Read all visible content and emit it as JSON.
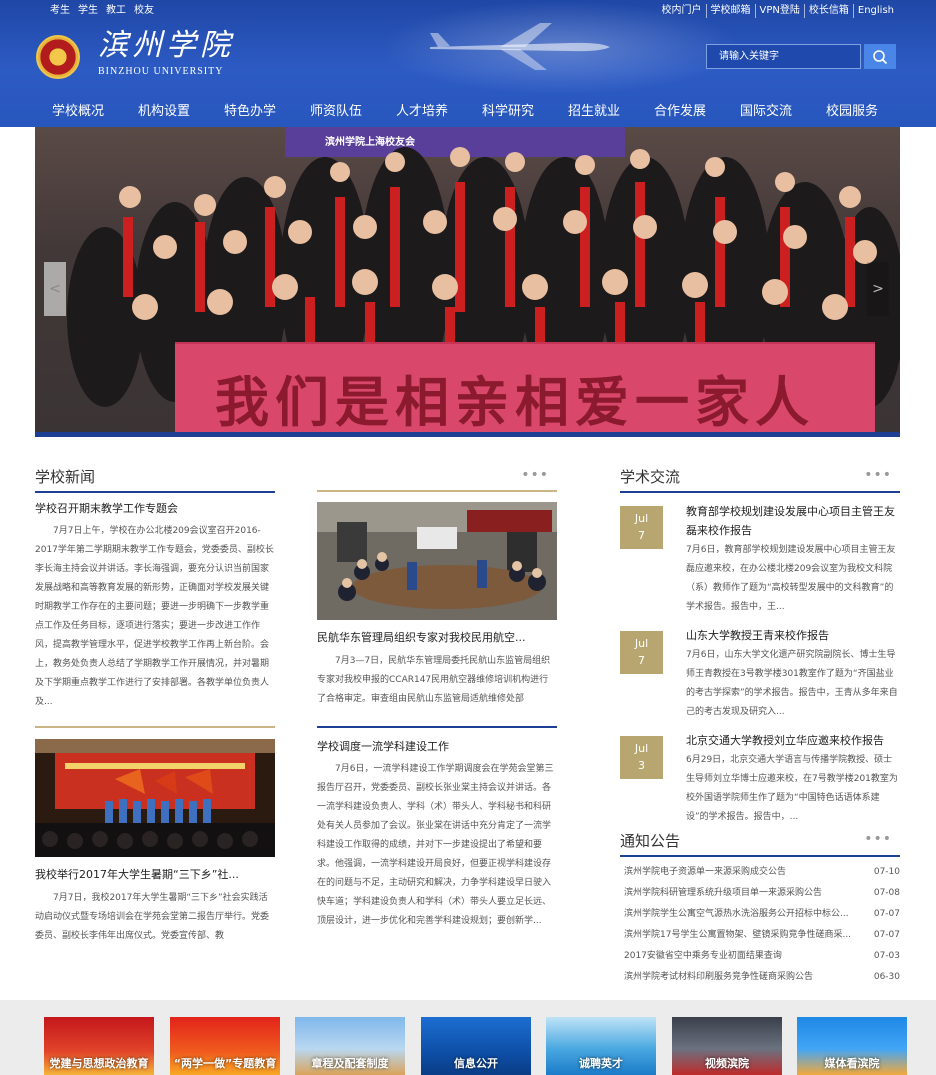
{
  "topnav": {
    "left": [
      "考生",
      "学生",
      "教工",
      "校友"
    ],
    "right": [
      "校内门户",
      "学校邮箱",
      "VPN登陆",
      "校长信箱",
      "English"
    ]
  },
  "logo": {
    "cn": "滨州学院",
    "en": "BINZHOU UNIVERSITY"
  },
  "search": {
    "placeholder": "请输入关键字"
  },
  "mainnav": [
    "学校概况",
    "机构设置",
    "特色办学",
    "师资队伍",
    "人才培养",
    "科学研究",
    "招生就业",
    "合作发展",
    "国际交流",
    "校园服务"
  ],
  "banner": {
    "wall_text": "滨州学院上海校友会",
    "slogan": "我们是相亲相爱一家人",
    "prev": "<",
    "next": ">"
  },
  "school_news": {
    "heading": "学校新闻",
    "more": "•••",
    "items": [
      {
        "title": "学校召开期末教学工作专题会",
        "body": "7月7日上午，学校在办公北楼209会议室召开2016-2017学年第二学期期末教学工作专题会，党委委员、副校长李长海主持会议并讲话。李长海强调，要充分认识当前国家发展战略和高等教育发展的新形势，正确面对学校发展关键时期教学工作存在的主要问题；要进一步明确下一步教学重点工作及任务目标，逐项进行落实；要进一步改进工作作风，提高教学管理水平，促进学校教学工作再上新台阶。会上，教务处负责人总结了学期教学工作开展情况，并对暑期及下学期重点教学工作进行了安排部署。各教学单位负责人及..."
      },
      {
        "title": "民航华东管理局组织专家对我校民用航空...",
        "body": "7月3—7日，民航华东管理局委托民航山东监管局组织专家对我校申报的CCAR147民用航空器维修培训机构进行了合格审定。审查组由民航山东监管局适航维修处部"
      },
      {
        "title": "我校举行2017年大学生暑期“三下乡”社...",
        "body": "7月7日，我校2017年大学生暑期“三下乡”社会实践活动启动仪式暨专场培训会在学苑会堂第二报告厅举行。党委委员、副校长李伟年出席仪式。党委宣传部、教"
      },
      {
        "title": "学校调度一流学科建设工作",
        "body": "7月6日，一流学科建设工作学期调度会在学苑会堂第三报告厅召开，党委委员、副校长张业棠主持会议并讲话。各一流学科建设负责人、学科（术）带头人、学科秘书和科研处有关人员参加了会议。张业棠在讲话中充分肯定了一流学科建设工作取得的成绩，并对下一步建设提出了希望和要求。他强调，一流学科建设开局良好，但要正视学科建设存在的问题与不足，主动研究和解决，力争学科建设早日驶入快车道；学科建设负责人和学科（术）带头人要立足长远、顶层设计，进一步优化和完善学科建设规划；要创新学..."
      }
    ]
  },
  "academic": {
    "heading": "学术交流",
    "more": "•••",
    "items": [
      {
        "month": "Jul",
        "day": "7",
        "title": "教育部学校规划建设发展中心项目主管王友磊来校作报告",
        "body": "7月6日，教育部学校规划建设发展中心项目主管王友磊应邀来校，在办公楼北楼209会议室为我校文科院（系）教师作了题为“高校转型发展中的文科教育”的学术报告。报告中，王..."
      },
      {
        "month": "Jul",
        "day": "7",
        "title": "山东大学教授王青来校作报告",
        "body": "7月6日，山东大学文化遗产研究院副院长、博士生导师王青教授在3号教学楼301教室作了题为“齐国盐业的考古学探索”的学术报告。报告中，王青从多年来自己的考古发现及研究入..."
      },
      {
        "month": "Jul",
        "day": "3",
        "title": "北京交通大学教授刘立华应邀来校作报告",
        "body": "6月29日，北京交通大学语言与传播学院教授、硕士生导师刘立华博士应邀来校，在7号教学楼201教室为校外国语学院师生作了题为“中国特色话语体系建设”的学术报告。报告中，..."
      }
    ]
  },
  "notices": {
    "heading": "通知公告",
    "more": "•••",
    "items": [
      {
        "title": "滨州学院电子资源单一来源采购成交公告",
        "date": "07-10"
      },
      {
        "title": "滨州学院科研管理系统升级项目单一来源采购公告",
        "date": "07-08"
      },
      {
        "title": "滨州学院学生公寓空气源热水洗浴服务公开招标中标公...",
        "date": "07-07"
      },
      {
        "title": "滨州学院17号学生公寓置物架、壁镜采购竞争性磋商采...",
        "date": "07-07"
      },
      {
        "title": "2017安徽省空中乘务专业初面结果查询",
        "date": "07-03"
      },
      {
        "title": "滨州学院考试材料印刷服务竞争性磋商采购公告",
        "date": "06-30"
      }
    ]
  },
  "footer_tiles": [
    "党建与思想政治教育",
    "“两学一做”专题教育",
    "章程及配套制度",
    "信息公开",
    "诚聘英才",
    "视频滨院",
    "媒体看滨院"
  ],
  "colors": {
    "header_blue": "#2756bd",
    "nav_underline": "#1e3f96",
    "gold": "#b8a670",
    "banner_red": "#d9486a"
  }
}
